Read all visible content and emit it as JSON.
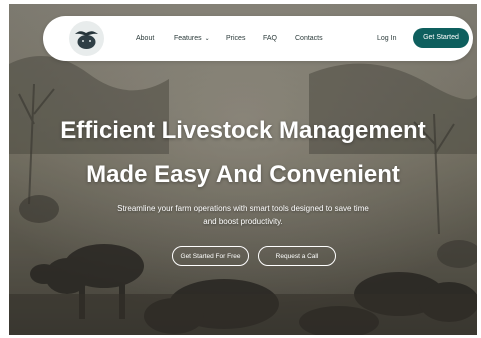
{
  "nav": {
    "logo_name": "buffalo-logo-icon",
    "links": {
      "about": "About",
      "features": "Features",
      "prices": "Prices",
      "faq": "FAQ",
      "contacts": "Contacts"
    },
    "login": "Log In",
    "get_started": "Get Started"
  },
  "hero": {
    "title_line1": "Efficient Livestock Management",
    "title_line2": "Made Easy And Convenient",
    "subtitle_line1": "Streamline your farm operations with smart tools designed to save time",
    "subtitle_line2": "and boost productivity.",
    "primary_cta": "Get Started For Free",
    "secondary_cta": "Request a Call"
  },
  "colors": {
    "accent": "#0e5f5e",
    "nav_bg": "#ffffff",
    "hero_text": "#ffffff"
  }
}
